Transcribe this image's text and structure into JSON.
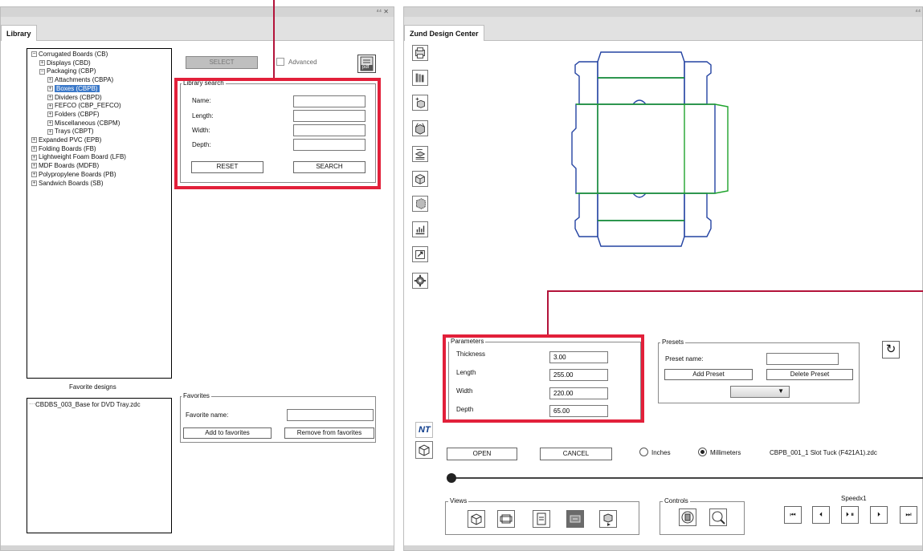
{
  "library": {
    "tab": "Library",
    "panel_controls": "⁴⁴  ✕",
    "tree": [
      {
        "label": "Corrugated Boards (CB)",
        "sign": "−"
      },
      {
        "label": "Displays (CBD)",
        "sign": "+"
      },
      {
        "label": "Packaging (CBP)",
        "sign": "−"
      },
      {
        "label": "Attachments (CBPA)",
        "sign": "+"
      },
      {
        "label": "Boxes (CBPB)",
        "sign": "+"
      },
      {
        "label": "Dividers (CBPD)",
        "sign": "+"
      },
      {
        "label": "FEFCO (CBP_FEFCO)",
        "sign": "+"
      },
      {
        "label": "Folders (CBPF)",
        "sign": "+"
      },
      {
        "label": "Miscellaneous (CBPM)",
        "sign": "+"
      },
      {
        "label": "Trays (CBPT)",
        "sign": "+"
      },
      {
        "label": "Expanded PVC (EPB)",
        "sign": "+"
      },
      {
        "label": "Folding Boards (FB)",
        "sign": "+"
      },
      {
        "label": "Lightweight Foam Board (LFB)",
        "sign": "+"
      },
      {
        "label": "MDF Boards (MDFB)",
        "sign": "+"
      },
      {
        "label": "Polypropylene Boards (PB)",
        "sign": "+"
      },
      {
        "label": "Sandwich Boards (SB)",
        "sign": "+"
      }
    ],
    "select_label": "SELECT",
    "advanced_label": "Advanced",
    "pdf_label": "pdf",
    "search": {
      "legend": "Library search",
      "name_label": "Name:",
      "length_label": "Length:",
      "width_label": "Width:",
      "depth_label": "Depth:",
      "name_value": "",
      "length_value": "",
      "width_value": "",
      "depth_value": "",
      "reset_label": "RESET",
      "search_label": "SEARCH"
    },
    "favorite_designs_label": "Favorite designs",
    "favorite_item": "CBDBS_003_Base for DVD Tray.zdc",
    "favorites": {
      "legend": "Favorites",
      "name_label": "Favorite name:",
      "name_value": "",
      "add_label": "Add to favorites",
      "remove_label": "Remove from favorites"
    }
  },
  "design": {
    "tab": "Zund Design Center",
    "panel_controls": "⁴⁴",
    "tools": [
      "print-icon",
      "cardboard-stack-icon",
      "box-add-icon",
      "box-open-icon",
      "box-flat-icon",
      "box-3d-icon",
      "box-sheet-icon",
      "chart-icon",
      "export-icon",
      "settings-gear-icon"
    ],
    "parameters": {
      "legend": "Parameters",
      "thickness_label": "Thickness",
      "thickness_value": "3.00",
      "length_label": "Length",
      "length_value": "255.00",
      "width_label": "Width",
      "width_value": "220.00",
      "depth_label": "Depth",
      "depth_value": "65.00"
    },
    "presets": {
      "legend": "Presets",
      "name_label": "Preset name:",
      "name_value": "",
      "add_label": "Add Preset",
      "delete_label": "Delete Preset",
      "dropdown_value": ""
    },
    "nt_label": "NT",
    "open_label": "OPEN",
    "cancel_label": "CANCEL",
    "units": {
      "inches": "Inches",
      "millimeters": "Millimeters",
      "selected": "millimeters"
    },
    "filename": "CBPB_001_1 Slot Tuck (F421A1).zdc",
    "slider_fraction": 0.0,
    "views_legend": "Views",
    "controls_legend": "Controls",
    "speed_label": "Speedx1",
    "media": [
      "⏮",
      "⏴",
      "⏵ ⏸",
      "⏵",
      "⏭"
    ],
    "colors": {
      "outline": "#2443a2",
      "fold": "#1fa32c",
      "highlight": "#e2203a"
    }
  }
}
